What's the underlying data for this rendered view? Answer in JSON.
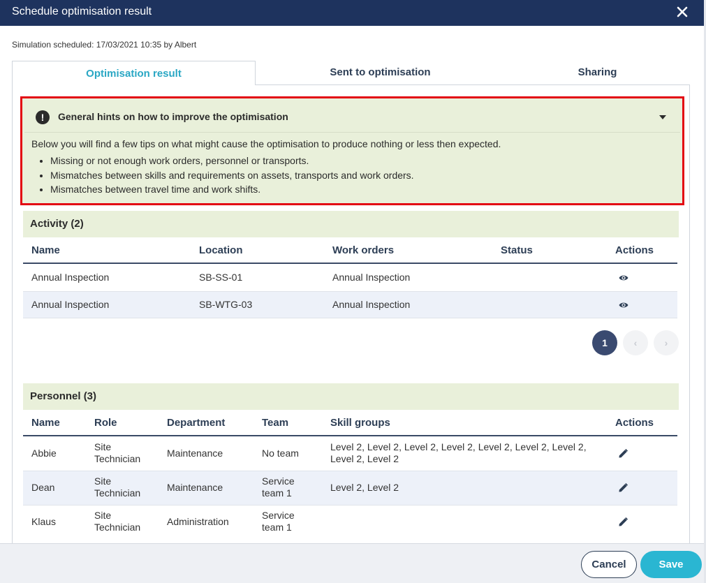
{
  "dialog": {
    "title": "Schedule optimisation result"
  },
  "scheduled_text": "Simulation scheduled: 17/03/2021 10:35 by Albert",
  "tabs": [
    {
      "label": "Optimisation result",
      "active": true
    },
    {
      "label": "Sent to optimisation",
      "active": false
    },
    {
      "label": "Sharing",
      "active": false
    }
  ],
  "hints": {
    "icon": "exclamation-icon",
    "title": "General hints on how to improve the optimisation",
    "intro": "Below you will find a few tips on what might cause the optimisation to produce nothing or less then expected.",
    "items": [
      "Missing or not enough work orders, personnel or transports.",
      "Mismatches between skills and requirements on assets, transports and work orders.",
      "Mismatches between travel time and work shifts."
    ]
  },
  "activity": {
    "title": "Activity (2)",
    "columns": [
      "Name",
      "Location",
      "Work orders",
      "Status",
      "Actions"
    ],
    "rows": [
      {
        "name": "Annual Inspection",
        "location": "SB-SS-01",
        "work_orders": "Annual Inspection",
        "status": ""
      },
      {
        "name": "Annual Inspection",
        "location": "SB-WTG-03",
        "work_orders": "Annual Inspection",
        "status": ""
      }
    ],
    "pagination": {
      "current": "1",
      "prev": "‹",
      "next": "›"
    }
  },
  "personnel": {
    "title": "Personnel (3)",
    "columns": [
      "Name",
      "Role",
      "Department",
      "Team",
      "Skill groups",
      "Actions"
    ],
    "rows": [
      {
        "name": "Abbie",
        "role_1": "Site",
        "role_2": "Technician",
        "department": "Maintenance",
        "team_1": "No team",
        "team_2": "",
        "skills_1": "Level 2, Level 2, Level 2, Level 2, Level 2, Level 2, Level 2,",
        "skills_2": "Level 2, Level 2"
      },
      {
        "name": "Dean",
        "role_1": "Site",
        "role_2": "Technician",
        "department": "Maintenance",
        "team_1": "Service",
        "team_2": "team 1",
        "skills_1": "Level 2, Level 2",
        "skills_2": ""
      },
      {
        "name": "Klaus",
        "role_1": "Site",
        "role_2": "Technician",
        "department": "Administration",
        "team_1": "Service",
        "team_2": "team 1",
        "skills_1": "",
        "skills_2": ""
      }
    ]
  },
  "footer": {
    "cancel_label": "Cancel",
    "save_label": "Save"
  },
  "colors": {
    "header": "#1e335e",
    "accent": "#2ab6d2",
    "hint_bg": "#e9f0da",
    "highlight_border": "#e30613"
  }
}
